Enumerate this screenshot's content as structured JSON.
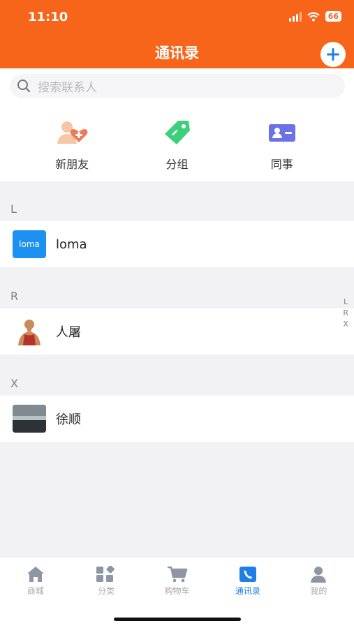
{
  "status_bar": {
    "time": "11:10",
    "battery": "66"
  },
  "header": {
    "title": "通讯录",
    "add_icon": "plus-icon"
  },
  "search": {
    "placeholder": "搜索联系人"
  },
  "quick_actions": [
    {
      "label": "新朋友",
      "icon": "new-friend-icon"
    },
    {
      "label": "分组",
      "icon": "tag-icon"
    },
    {
      "label": "同事",
      "icon": "id-card-icon"
    }
  ],
  "sections": [
    {
      "letter": "L",
      "contacts": [
        {
          "name": "loma",
          "avatar_text": "loma"
        }
      ]
    },
    {
      "letter": "R",
      "contacts": [
        {
          "name": "人屠"
        }
      ]
    },
    {
      "letter": "X",
      "contacts": [
        {
          "name": "徐顺"
        }
      ]
    }
  ],
  "index_letters": [
    "L",
    "R",
    "X"
  ],
  "tabbar": {
    "items": [
      {
        "label": "商城",
        "icon": "home-icon"
      },
      {
        "label": "分类",
        "icon": "category-icon"
      },
      {
        "label": "购物车",
        "icon": "cart-icon"
      },
      {
        "label": "通讯录",
        "icon": "contacts-icon",
        "active": true
      },
      {
        "label": "我的",
        "icon": "user-icon"
      }
    ]
  },
  "colors": {
    "header": "#f7651b",
    "active_tab": "#1f7fe6",
    "tag_green": "#3ccf7c",
    "card_purple": "#6b72e8"
  }
}
